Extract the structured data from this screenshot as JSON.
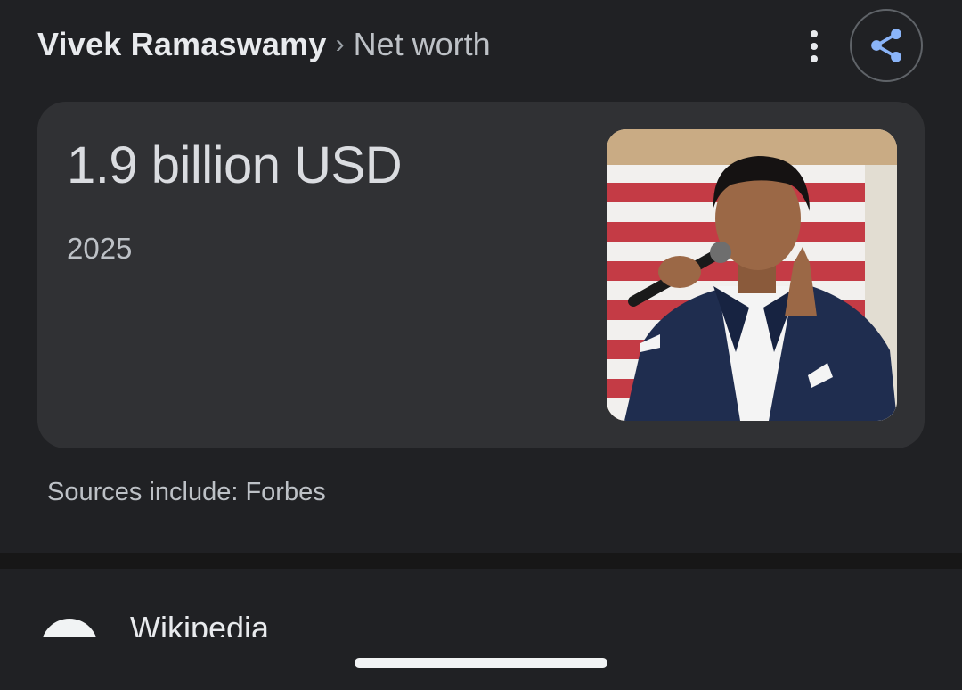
{
  "header": {
    "breadcrumb_primary": "Vivek Ramaswamy",
    "breadcrumb_separator": "›",
    "breadcrumb_secondary": "Net worth",
    "more_icon": "more-vertical-icon",
    "share_icon": "share-icon"
  },
  "answer_card": {
    "value": "1.9 billion USD",
    "year": "2025",
    "image_subject": "man in navy suit speaking into microphone with flag backdrop"
  },
  "sources_text": "Sources include: Forbes",
  "next_result": {
    "title": "Wikipedia",
    "favicon": "wikipedia-favicon"
  },
  "colors": {
    "background": "#202124",
    "card": "#303134",
    "share_accent": "#8ab4f8"
  }
}
